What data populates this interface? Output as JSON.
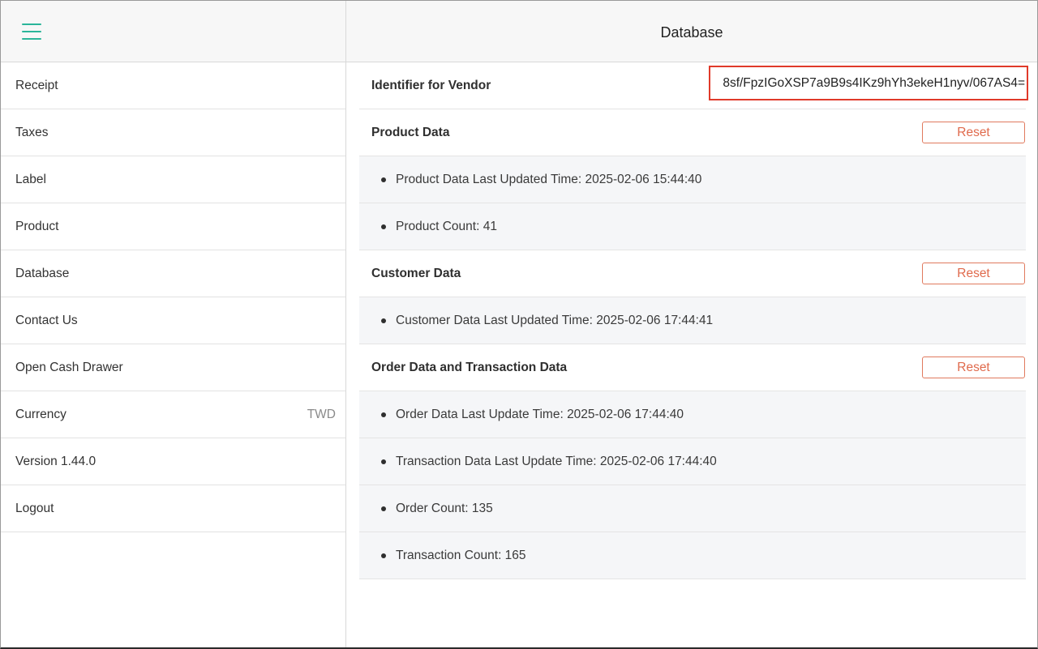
{
  "header": {
    "title": "Database"
  },
  "sidebar": {
    "items": [
      {
        "label": "Receipt",
        "value": ""
      },
      {
        "label": "Taxes",
        "value": ""
      },
      {
        "label": "Label",
        "value": ""
      },
      {
        "label": "Product",
        "value": ""
      },
      {
        "label": "Database",
        "value": ""
      },
      {
        "label": "Contact Us",
        "value": ""
      },
      {
        "label": "Open Cash Drawer",
        "value": ""
      },
      {
        "label": "Currency",
        "value": "TWD"
      },
      {
        "label": "Version 1.44.0",
        "value": ""
      },
      {
        "label": "Logout",
        "value": ""
      }
    ]
  },
  "main": {
    "vendor": {
      "label": "Identifier for Vendor",
      "value": "8sf/FpzIGoXSP7a9B9s4IKz9hYh3ekeH1nyv/067AS4="
    },
    "product": {
      "title": "Product Data",
      "reset_label": "Reset",
      "details": [
        "Product Data Last Updated Time: 2025-02-06 15:44:40",
        "Product Count: 41"
      ]
    },
    "customer": {
      "title": "Customer Data",
      "reset_label": "Reset",
      "details": [
        "Customer Data Last Updated Time: 2025-02-06 17:44:41"
      ]
    },
    "order": {
      "title": "Order Data and Transaction Data",
      "reset_label": "Reset",
      "details": [
        "Order Data Last Update Time: 2025-02-06 17:44:40",
        "Transaction Data Last Update Time: 2025-02-06 17:44:40",
        "Order Count: 135",
        "Transaction Count: 165"
      ]
    }
  }
}
